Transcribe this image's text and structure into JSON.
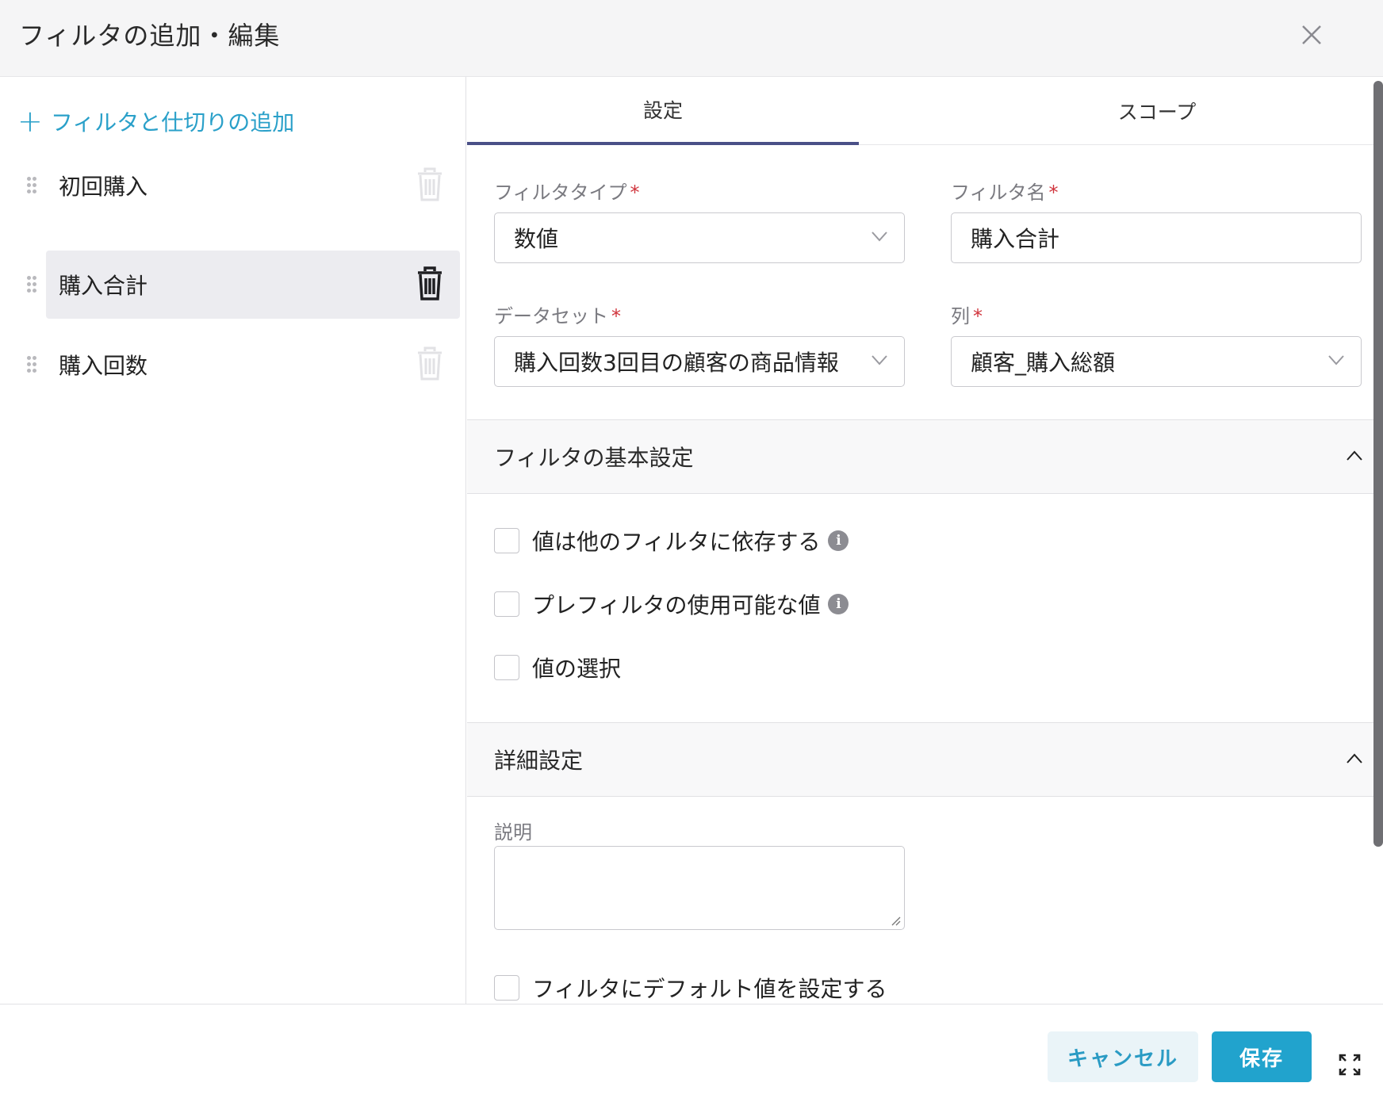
{
  "dialog": {
    "title": "フィルタの追加・編集"
  },
  "sidebar": {
    "add_label": "フィルタと仕切りの追加",
    "items": [
      {
        "label": "初回購入",
        "active": false
      },
      {
        "label": "購入合計",
        "active": true
      },
      {
        "label": "購入回数",
        "active": false
      }
    ]
  },
  "tabs": [
    {
      "label": "設定",
      "active": true
    },
    {
      "label": "スコープ",
      "active": false
    }
  ],
  "form": {
    "filter_type": {
      "label": "フィルタタイプ",
      "required": "*",
      "value": "数値"
    },
    "filter_name": {
      "label": "フィルタ名",
      "required": "*",
      "value": "購入合計"
    },
    "dataset": {
      "label": "データセット",
      "required": "*",
      "value": "購入回数3回目の顧客の商品情報"
    },
    "column": {
      "label": "列",
      "required": "*",
      "value": "顧客_購入総額"
    }
  },
  "basic_section": {
    "title": "フィルタの基本設定",
    "checkboxes": [
      {
        "label": "値は他のフィルタに依存する",
        "info": true,
        "checked": false
      },
      {
        "label": "プレフィルタの使用可能な値",
        "info": true,
        "checked": false
      },
      {
        "label": "値の選択",
        "info": false,
        "checked": false
      }
    ]
  },
  "advanced_section": {
    "title": "詳細設定",
    "description_label": "説明",
    "description_value": "",
    "default_checkbox_label": "フィルタにデフォルト値を設定する"
  },
  "footer": {
    "cancel_label": "キャンセル",
    "save_label": "保存"
  },
  "colors": {
    "accent": "#21a3cd",
    "link": "#2aa0c9",
    "tab_underline": "#4a5087",
    "required": "#d0343c"
  },
  "icons": {
    "close": "close-icon",
    "drag": "drag-handle-icon",
    "trash": "trash-icon",
    "chevron_down": "chevron-down-icon",
    "chevron_up": "chevron-up-icon",
    "info": "info-icon",
    "expand": "expand-icon"
  }
}
